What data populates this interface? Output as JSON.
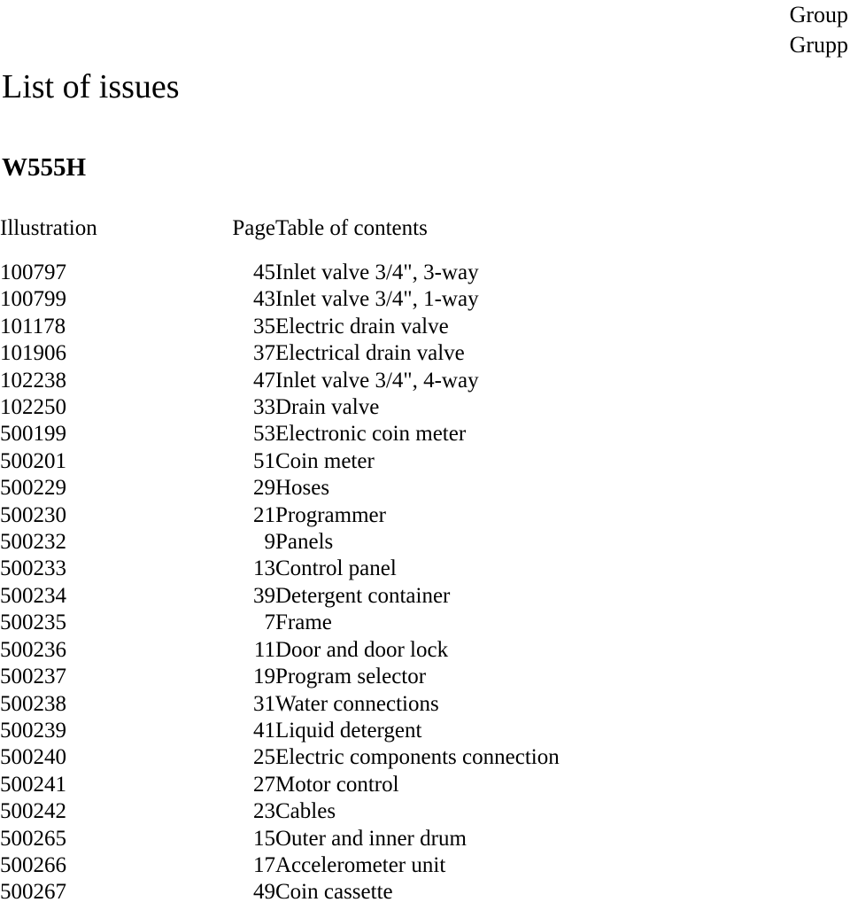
{
  "header": {
    "group_label_en": "Group",
    "group_label_sv": "Grupp"
  },
  "document": {
    "title": "List of issues",
    "model": "W555H"
  },
  "table": {
    "columns": {
      "illustration": "Illustration",
      "page": "Page",
      "contents": "Table of contents"
    },
    "rows": [
      {
        "illustration": "100797",
        "page": "45",
        "contents": "Inlet valve 3/4\", 3-way"
      },
      {
        "illustration": "100799",
        "page": "43",
        "contents": "Inlet valve 3/4\", 1-way"
      },
      {
        "illustration": "101178",
        "page": "35",
        "contents": "Electric drain valve"
      },
      {
        "illustration": "101906",
        "page": "37",
        "contents": "Electrical drain valve"
      },
      {
        "illustration": "102238",
        "page": "47",
        "contents": "Inlet valve 3/4\", 4-way"
      },
      {
        "illustration": "102250",
        "page": "33",
        "contents": "Drain valve"
      },
      {
        "illustration": "500199",
        "page": "53",
        "contents": "Electronic coin meter"
      },
      {
        "illustration": "500201",
        "page": "51",
        "contents": "Coin meter"
      },
      {
        "illustration": "500229",
        "page": "29",
        "contents": "Hoses"
      },
      {
        "illustration": "500230",
        "page": "21",
        "contents": "Programmer"
      },
      {
        "illustration": "500232",
        "page": "9",
        "contents": "Panels"
      },
      {
        "illustration": "500233",
        "page": "13",
        "contents": "Control panel"
      },
      {
        "illustration": "500234",
        "page": "39",
        "contents": "Detergent container"
      },
      {
        "illustration": "500235",
        "page": "7",
        "contents": "Frame"
      },
      {
        "illustration": "500236",
        "page": "11",
        "contents": "Door and door lock"
      },
      {
        "illustration": "500237",
        "page": "19",
        "contents": "Program selector"
      },
      {
        "illustration": "500238",
        "page": "31",
        "contents": "Water connections"
      },
      {
        "illustration": "500239",
        "page": "41",
        "contents": "Liquid detergent"
      },
      {
        "illustration": "500240",
        "page": "25",
        "contents": "Electric components connection"
      },
      {
        "illustration": "500241",
        "page": "27",
        "contents": "Motor control"
      },
      {
        "illustration": "500242",
        "page": "23",
        "contents": "Cables"
      },
      {
        "illustration": "500265",
        "page": "15",
        "contents": "Outer and inner drum"
      },
      {
        "illustration": "500266",
        "page": "17",
        "contents": "Accelerometer unit"
      },
      {
        "illustration": "500267",
        "page": "49",
        "contents": "Coin cassette"
      }
    ]
  }
}
